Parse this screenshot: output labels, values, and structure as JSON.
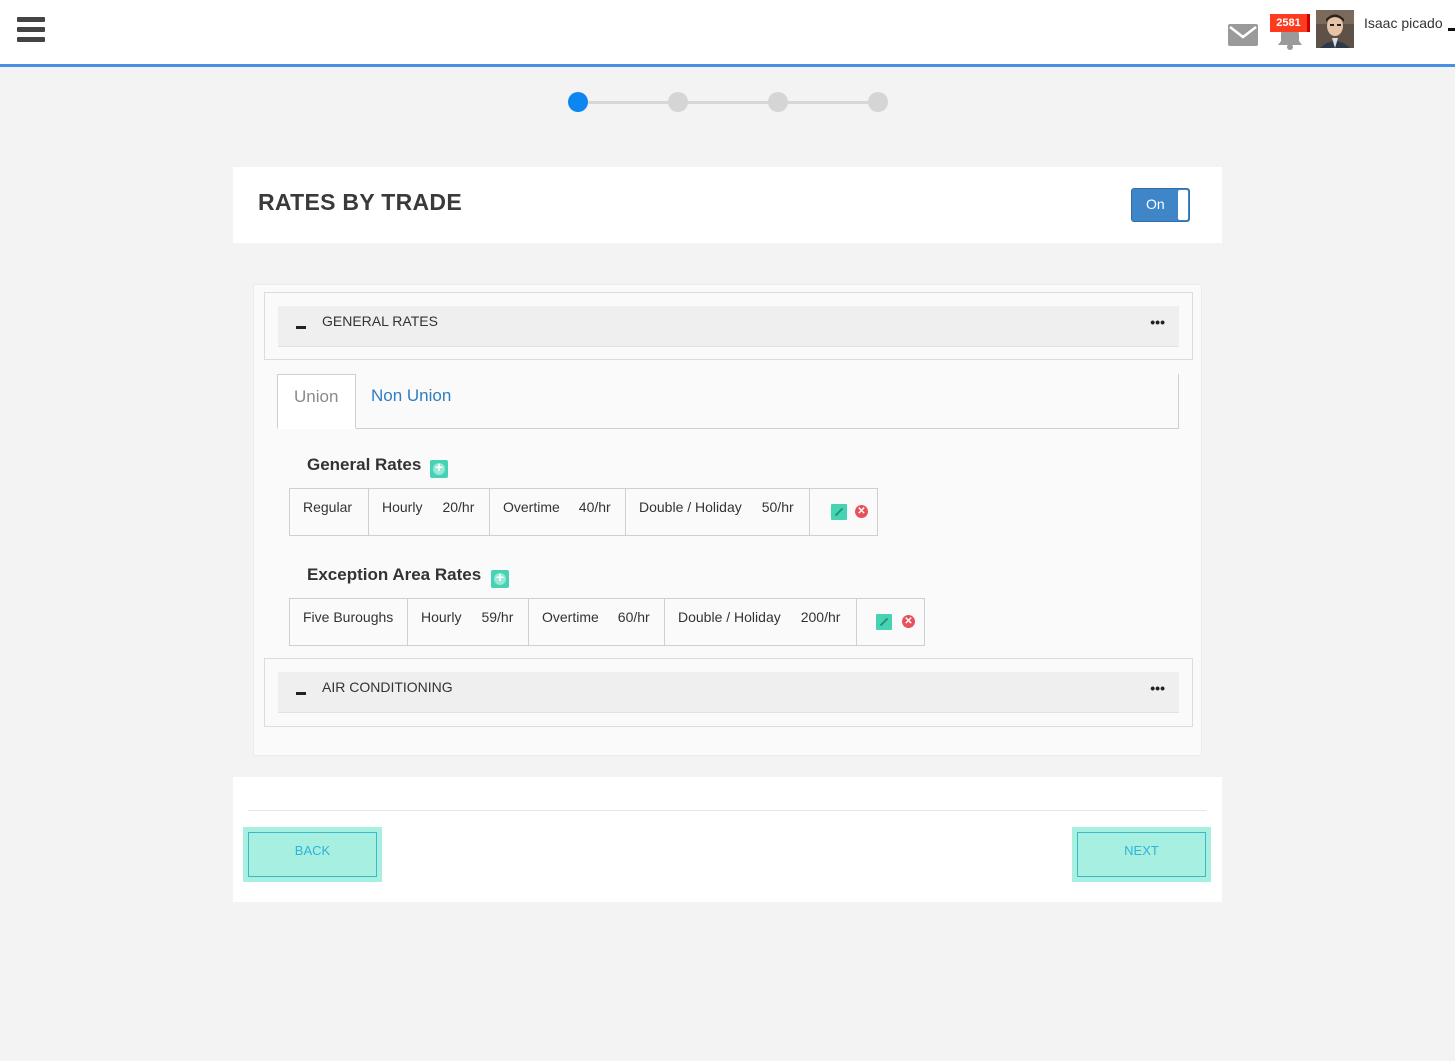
{
  "header": {
    "user_name": "Isaac picado",
    "notification_count": "2581"
  },
  "stepper": {
    "total_steps": 4,
    "current_step": 1
  },
  "card": {
    "title": "RATES BY TRADE",
    "toggle_label": "On"
  },
  "sections": [
    {
      "title": "GENERAL RATES"
    },
    {
      "title": "AIR CONDITIONING"
    }
  ],
  "tabs": [
    {
      "label": "Union"
    },
    {
      "label": "Non Union"
    }
  ],
  "general_rates": {
    "heading": "General Rates",
    "row": {
      "name": "Regular",
      "hourly_label": "Hourly",
      "hourly_value": "20/hr",
      "overtime_label": "Overtime",
      "overtime_value": "40/hr",
      "holiday_label": "Double / Holiday",
      "holiday_value": "50/hr"
    }
  },
  "exception_rates": {
    "heading": "Exception Area Rates",
    "row": {
      "name": "Five Buroughs",
      "hourly_label": "Hourly",
      "hourly_value": "59/hr",
      "overtime_label": "Overtime",
      "overtime_value": "60/hr",
      "holiday_label": "Double / Holiday",
      "holiday_value": "200/hr"
    }
  },
  "footer": {
    "back_label": "BACK",
    "next_label": "NEXT"
  },
  "colors": {
    "accent": "#4a90e2",
    "active_step": "#0d86f2",
    "toggle_bg": "#3e86c8",
    "action_teal": "#46d3b4",
    "delete_red": "#e8505b",
    "badge_red": "#ff3b1f"
  }
}
